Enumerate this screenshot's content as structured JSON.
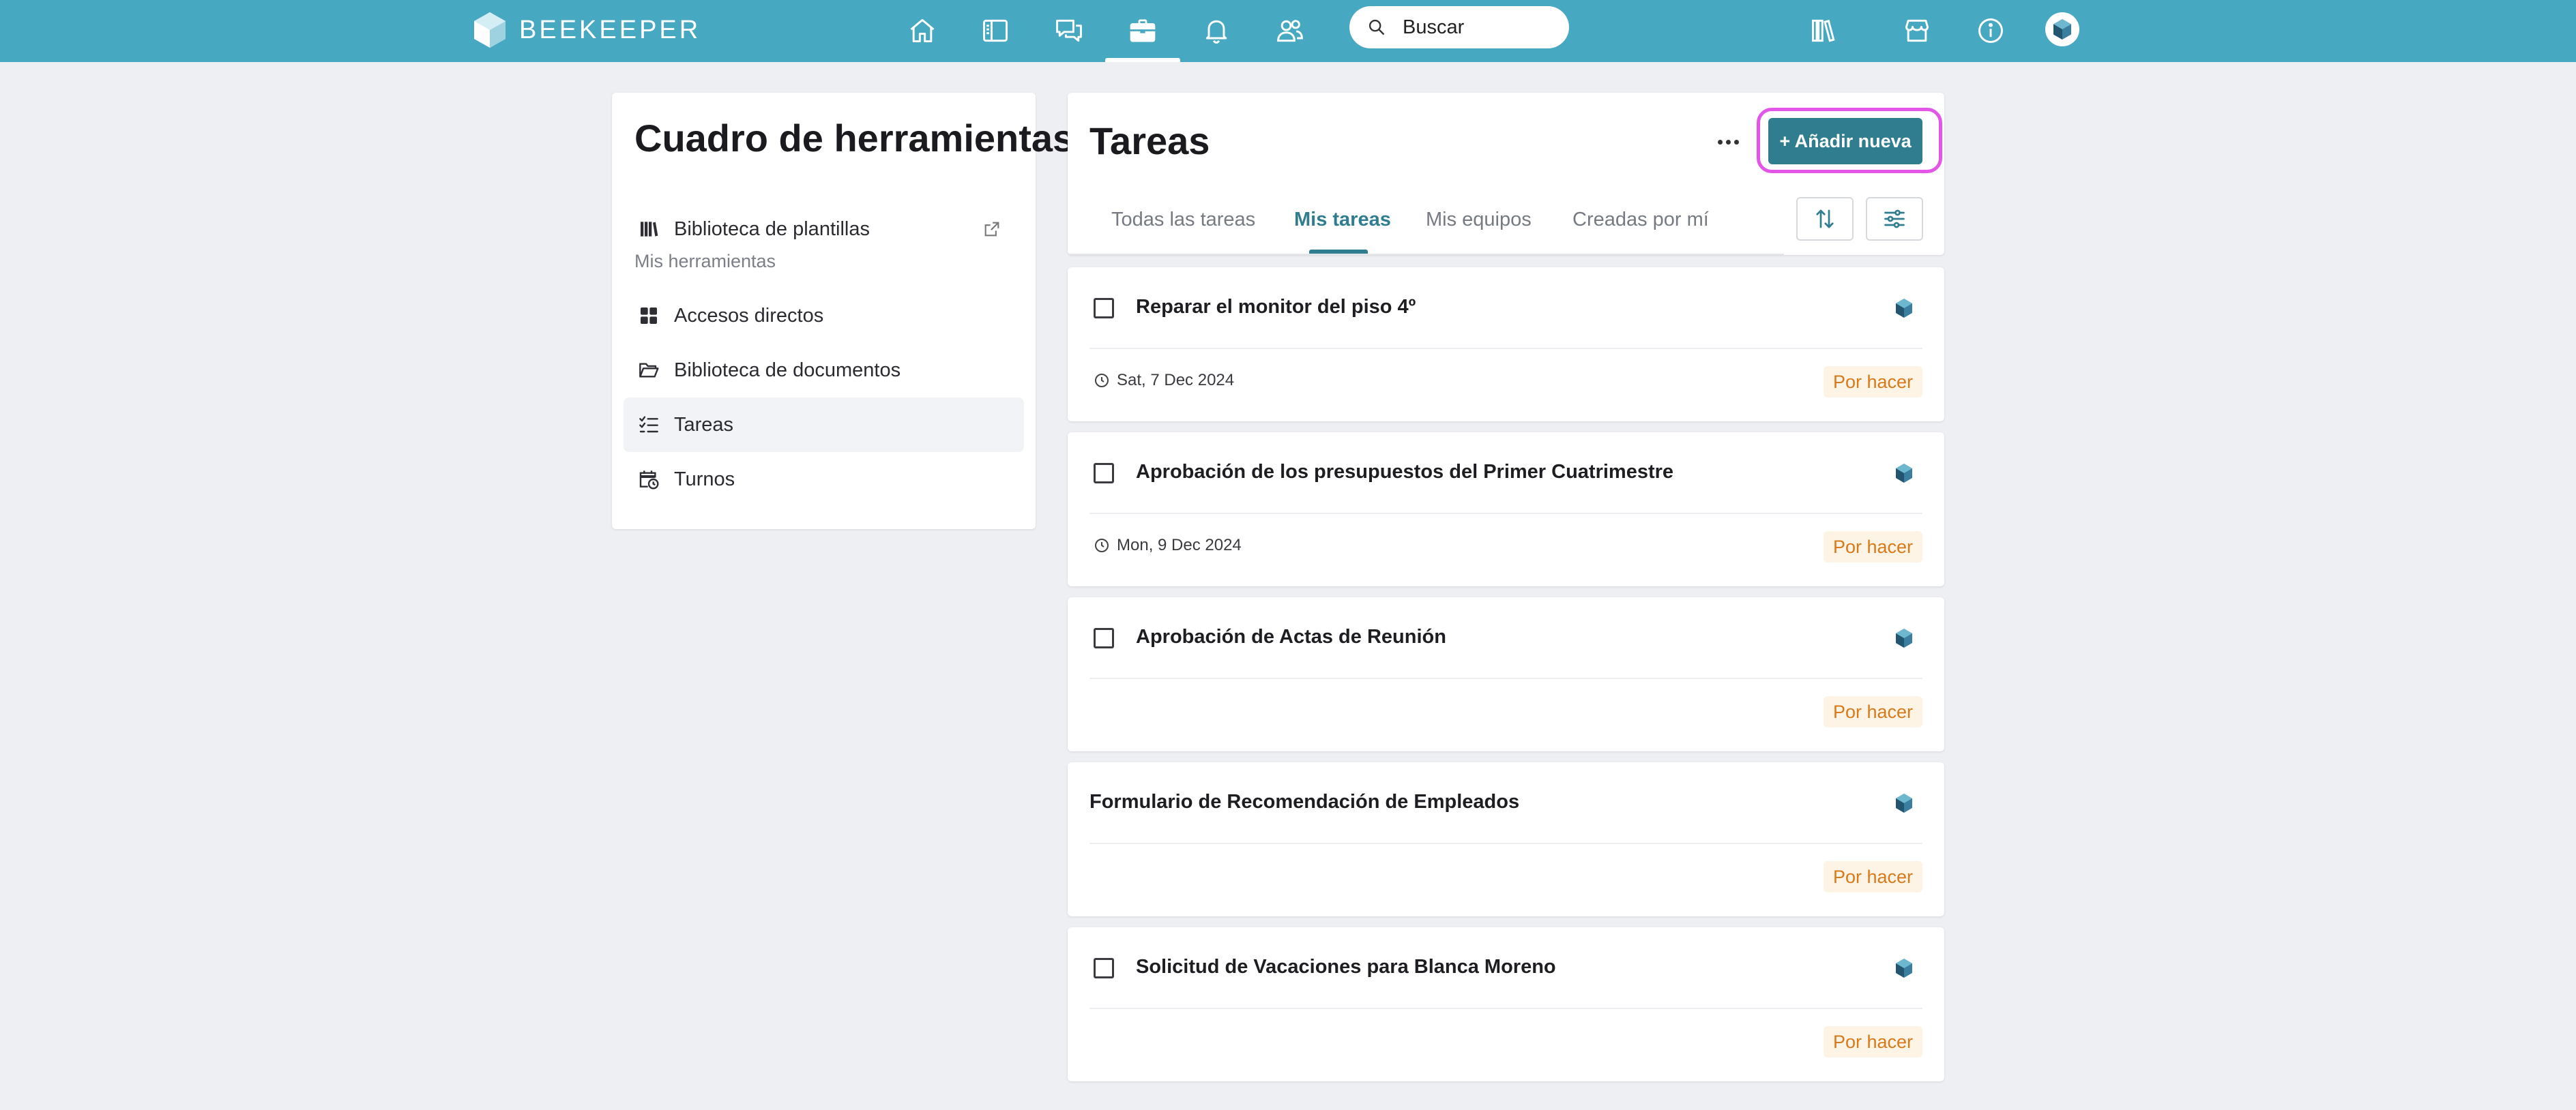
{
  "brand": {
    "name": "BEEKEEPER",
    "topbar_color": "#47a8c2",
    "accent": "#2f7d8f",
    "highlight": "#e355e6"
  },
  "topnav": {
    "items": [
      {
        "name": "home-icon"
      },
      {
        "name": "streams-icon"
      },
      {
        "name": "chats-icon"
      },
      {
        "name": "toolbox-icon",
        "active": true
      },
      {
        "name": "bell-icon"
      },
      {
        "name": "people-icon"
      }
    ],
    "search_placeholder": "Buscar",
    "right_icons": [
      "library-icon",
      "store-icon",
      "info-icon",
      "avatar"
    ]
  },
  "sidebar": {
    "title": "Cuadro de herramientas",
    "template_link": "Biblioteca de plantillas",
    "section_label": "Mis herramientas",
    "items": [
      {
        "label": "Accesos directos",
        "icon": "grid-icon"
      },
      {
        "label": "Biblioteca de documentos",
        "icon": "folder-icon"
      },
      {
        "label": "Tareas",
        "icon": "checklist-icon",
        "active": true
      },
      {
        "label": "Turnos",
        "icon": "calendar-clock-icon"
      }
    ]
  },
  "main": {
    "title": "Tareas",
    "add_button": "+ Añadir nueva",
    "tabs": [
      {
        "label": "Todas las tareas"
      },
      {
        "label": "Mis tareas",
        "active": true
      },
      {
        "label": "Mis equipos"
      },
      {
        "label": "Creadas por mí"
      }
    ],
    "tasks": [
      {
        "title": "Reparar el monitor del piso 4º",
        "has_checkbox": true,
        "due": "Sat, 7 Dec 2024",
        "status": "Por hacer"
      },
      {
        "title": "Aprobación de los presupuestos del Primer Cuatrimestre",
        "has_checkbox": true,
        "due": "Mon, 9 Dec 2024",
        "status": "Por hacer"
      },
      {
        "title": "Aprobación de Actas de Reunión",
        "has_checkbox": true,
        "due": "",
        "status": "Por hacer"
      },
      {
        "title": "Formulario de Recomendación de Empleados",
        "has_checkbox": false,
        "due": "",
        "status": "Por hacer"
      },
      {
        "title": "Solicitud de Vacaciones para Blanca Moreno",
        "has_checkbox": true,
        "due": "",
        "status": "Por hacer"
      }
    ]
  }
}
